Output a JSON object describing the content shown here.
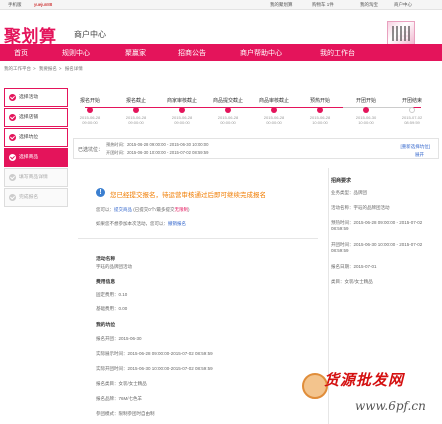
{
  "topbar": {
    "mobile": "手机版",
    "login": "yuejun88",
    "my_juhuasuan": "我的聚划算",
    "cart": "购物车 1件",
    "my_taobao": "我的淘宝",
    "seller_center": "商户中心"
  },
  "header": {
    "logo": "聚划算",
    "subtitle": "商户中心"
  },
  "nav": {
    "items": [
      "首页",
      "规则中心",
      "聚赢家",
      "招商公告",
      "商户帮助中心",
      "我的工作台"
    ]
  },
  "breadcrumb": [
    "我的工作平台",
    "我要报名",
    "报名详情"
  ],
  "sidebar": {
    "items": [
      {
        "label": "选择活动",
        "state": "done"
      },
      {
        "label": "选择店铺",
        "state": "done"
      },
      {
        "label": "选择坑位",
        "state": "done"
      },
      {
        "label": "选择商品",
        "state": "active"
      },
      {
        "label": "填写商品详情",
        "state": "disabled"
      },
      {
        "label": "完成报名",
        "state": "disabled"
      }
    ]
  },
  "steps": [
    {
      "title": "报名开始",
      "time": "2015-06-28\n09:00:00",
      "done": true
    },
    {
      "title": "报名截止",
      "time": "2015-06-28\n09:00:00",
      "done": true
    },
    {
      "title": "商家审核截止",
      "time": "2015-06-28\n09:00:00",
      "done": true
    },
    {
      "title": "商品提交截止",
      "time": "2015-06-28\n00:00:00",
      "done": true
    },
    {
      "title": "商品审核截止",
      "time": "2015-06-28\n00:00:00",
      "done": true
    },
    {
      "title": "预热开始",
      "time": "2015-06-28\n10:00:00",
      "done": true
    },
    {
      "title": "开团开始",
      "time": "2015-06-30\n10:00:00",
      "done": true
    },
    {
      "title": "开团结束",
      "time": "2015-07-02\n08:59:59",
      "done": false
    }
  ],
  "selected": {
    "label": "已选坑位：",
    "line1": "预热时间：2015-06-28 09:00:00 - 2015-06-30 10:00:00",
    "line2": "开团时间：2015-06-30 10:00:00 - 2015-07-02 08:59:59",
    "relink": "[重新选择坑位]",
    "expand": "展开"
  },
  "notice": {
    "title": "您已经提交报名，待运营审核通过后即可继续完成报名",
    "sub1_prefix": "您可以：",
    "sub1_link": "提交商品",
    "sub1_mid": "(已提交0个/最多提交",
    "sub1_red": "无限制",
    "sub1_end": ")",
    "sub2_prefix": "如果您不想参加本次活动，您可以：",
    "sub2_link": "撤销报名"
  },
  "details": {
    "activity_name_label": "活动名称",
    "activity_name": "宇珏的品牌团活动",
    "fee_label": "费用信息",
    "fixed_fee": "固定费用：0.10",
    "commission": "基础费用：0.00",
    "my_pit_label": "我的坑位",
    "date": "报名开团：2015-06-30",
    "preheat": "实际展示时间：2015-06-28 09:00:00-2015-07-02 08:59:59",
    "open": "实际开团时间：2015-06-30 10:00:00-2015-07-02 08:59:59",
    "category": "报名类目：女装/女士精品",
    "brand": "报名品牌：76M/七色羊",
    "type": "参团模式：限制参团时自由制"
  },
  "right": {
    "title": "招商要求",
    "lines": [
      "业务类型：品牌团",
      "活动名称：宇珏的品牌团活动",
      "预热时间：2015-06-28 09:00:00 - 2015-07-02 08:59:59",
      "开团时间：2015-06-30 10:00:00 - 2015-07-02 08:59:59",
      "报名日期：2015-07-01",
      "类目：女装/女士精品"
    ]
  },
  "watermark": {
    "text": "货源批发网",
    "url": "www.6pf.cn"
  }
}
